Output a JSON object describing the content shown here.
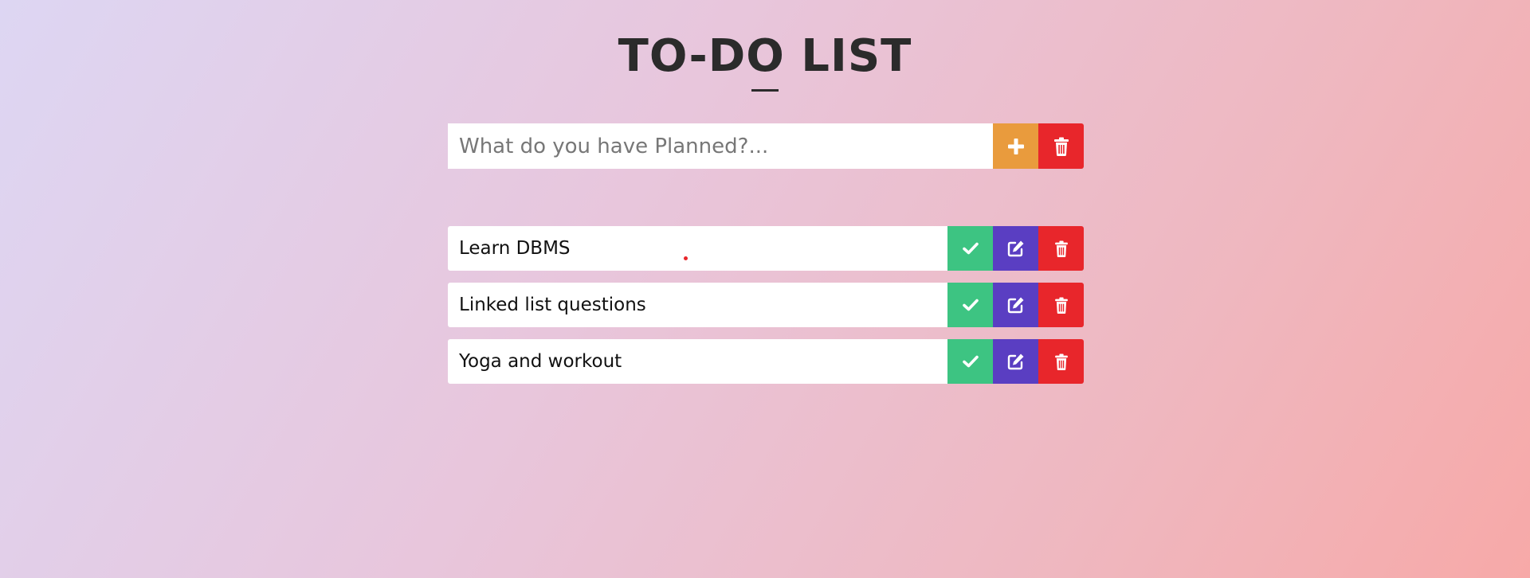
{
  "header": {
    "title": "TO-DO LIST"
  },
  "input": {
    "placeholder": "What do you have Planned?...",
    "value": ""
  },
  "tasks": [
    {
      "text": "Learn DBMS"
    },
    {
      "text": "Linked list questions"
    },
    {
      "text": "Yoga and workout"
    }
  ],
  "icons": {
    "add": "plus-icon",
    "clear": "trash-icon",
    "done": "check-icon",
    "edit": "edit-icon",
    "delete": "trash-icon"
  },
  "colors": {
    "add": "#e99b3d",
    "done": "#3dc482",
    "edit": "#5a3ec2",
    "delete": "#e8262b"
  }
}
